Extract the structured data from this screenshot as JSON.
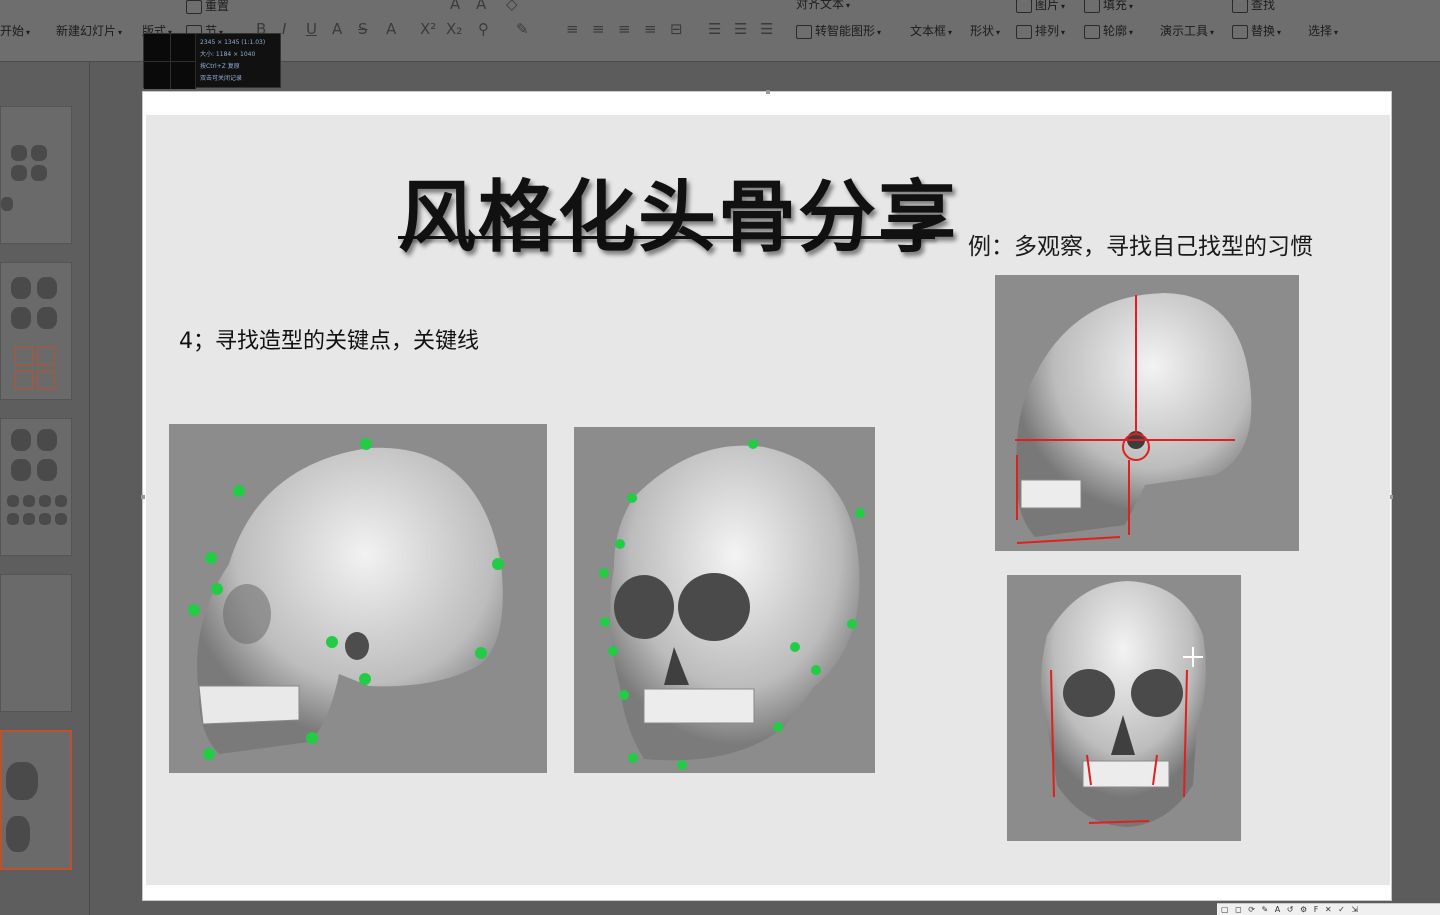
{
  "ribbon": {
    "start": "开始",
    "new_slide": "新建幻灯片",
    "layout": "版式",
    "section": "节",
    "reset": "重置",
    "smart_shape": "转智能图形",
    "text_box": "文本框",
    "shape": "形状",
    "arrange": "排列",
    "outline": "轮廓",
    "present_tools": "演示工具",
    "replace": "替换",
    "select": "选择",
    "find": "查找",
    "picture": "图片",
    "fill": "填充",
    "align_text": "对齐文本"
  },
  "size_tooltip": {
    "line1": "2345 × 1345 (1:1.03)",
    "line2": "大小: 1184 × 1040",
    "line3": "按Ctrl+Z 复原",
    "line4": "双击可关闭记录"
  },
  "slide": {
    "title": "风格化头骨分享",
    "subtitle": "例：多观察，寻找自己找型的习惯",
    "point": "4；寻找造型的关键点，关键线"
  },
  "statusbar": {
    "icons": "▢ ◻ ⟳ ✎ A ↺ ⚙ F ✕ ✓ ⇲"
  },
  "colors": {
    "keypoint": "#22cc44",
    "guide_line": "#e02020",
    "title": "#111111",
    "slide_bg": "#e7e7e7",
    "active_thumb": "#b8532e"
  }
}
